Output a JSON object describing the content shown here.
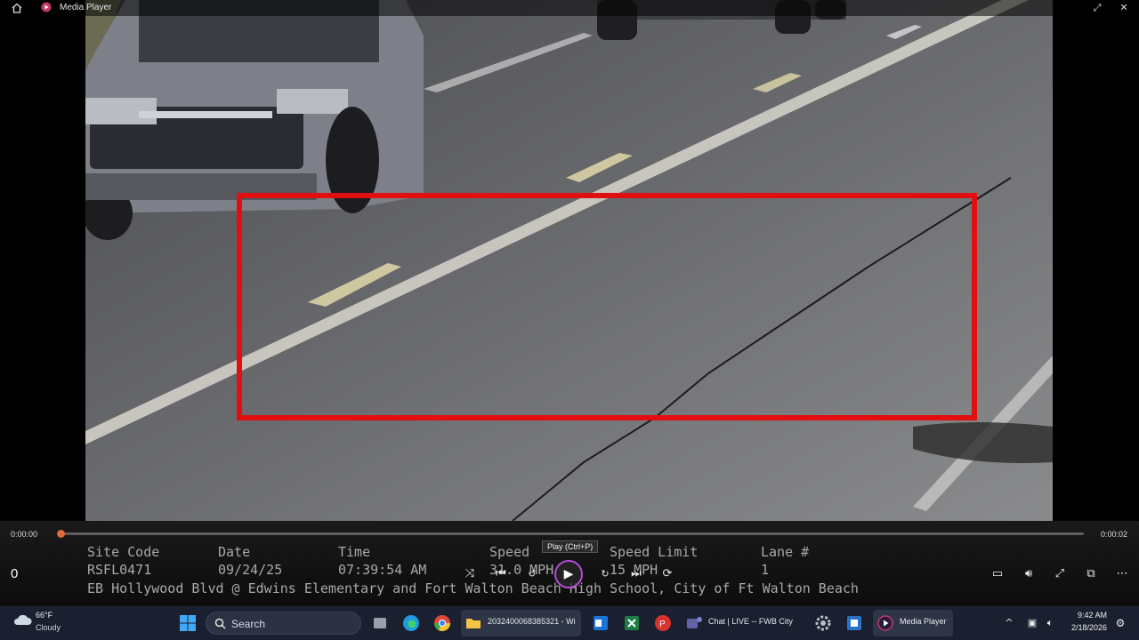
{
  "window": {
    "title": "Media Player",
    "controls": [
      "minimize-restore",
      "close"
    ]
  },
  "video_overlay": {
    "headers": {
      "site_code": "Site Code",
      "date": "Date",
      "time": "Time",
      "speed": "Speed",
      "speed_limit": "Speed Limit",
      "lane": "Lane #"
    },
    "values": {
      "site_code": "RSFL0471",
      "date": "09/24/25",
      "time": "07:39:54 AM",
      "speed": "31.0 MPH",
      "speed_limit": "15 MPH",
      "lane": "1"
    },
    "location": "EB Hollywood Blvd @ Edwins Elementary and Fort Walton Beach High School, City of Ft Walton Beach",
    "highlight_box_color": "#e01010"
  },
  "player": {
    "current_time": "0:00:00",
    "total_time": "0:00:02",
    "progress": 0.0,
    "counter": "0",
    "play_tooltip": "Play (Ctrl+P)",
    "accent_color": "#e06a3a",
    "buttons": [
      "shuffle-icon",
      "previous-icon",
      "rewind-10-icon",
      "play-icon",
      "forward-30-icon",
      "next-icon",
      "repeat-off-icon",
      "subtitles-icon",
      "volume-icon",
      "fullscreen-icon",
      "mini-player-icon",
      "more-icon"
    ]
  },
  "taskbar": {
    "weather_temp": "66°F",
    "weather_desc": "Cloudy",
    "search_placeholder": "Search",
    "apps": [
      {
        "name": "File Explorer",
        "label": "2032400068385321 - Wi"
      },
      {
        "name": "Chat",
        "label": "Chat | LIVE -- FWB City"
      },
      {
        "name": "Media Player",
        "label": "Media Player"
      }
    ],
    "time": "9:42 AM",
    "date": "2/18/2026"
  }
}
